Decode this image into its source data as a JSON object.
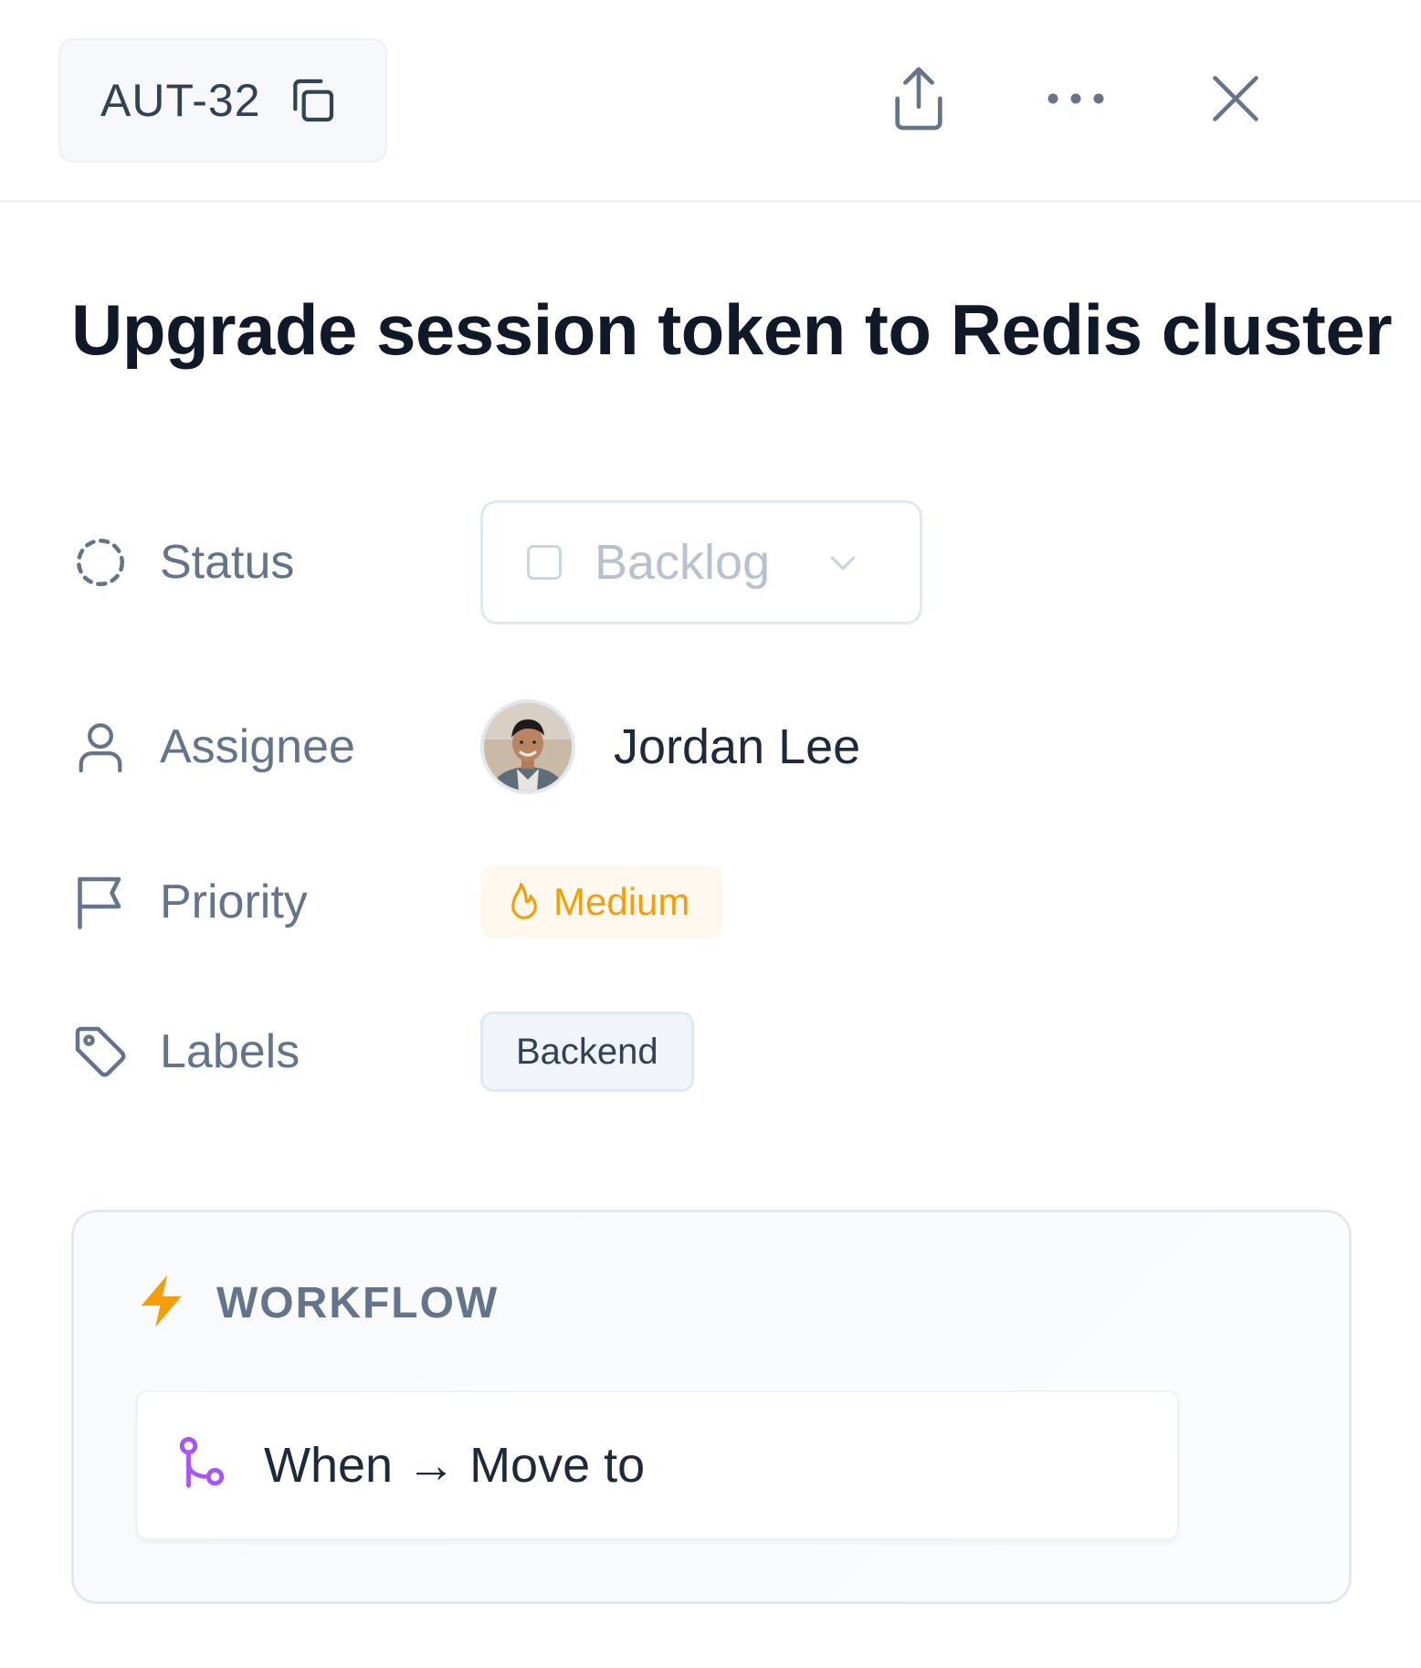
{
  "header": {
    "issue_id": "AUT-32",
    "icons": [
      "copy-icon",
      "share-icon",
      "more-icon",
      "close-icon"
    ]
  },
  "issue": {
    "title": "Upgrade session token to Redis cluster"
  },
  "properties": {
    "status": {
      "label": "Status",
      "value": "Backlog",
      "icon": "status-dashed-circle-icon"
    },
    "assignee": {
      "label": "Assignee",
      "value": "Jordan Lee",
      "icon": "user-icon"
    },
    "priority": {
      "label": "Priority",
      "value": "Medium",
      "icon": "flag-icon",
      "value_icon": "flame-icon",
      "color": "#f59e0b"
    },
    "labels": {
      "label": "Labels",
      "values": [
        "Backend"
      ],
      "icon": "tag-icon"
    }
  },
  "workflow": {
    "title": "WORKFLOW",
    "icon": "lightning-icon",
    "accent": "#f59e0b",
    "rule": {
      "text": "When → Move to",
      "icon": "git-branch-icon",
      "icon_color": "#a855f7"
    }
  }
}
